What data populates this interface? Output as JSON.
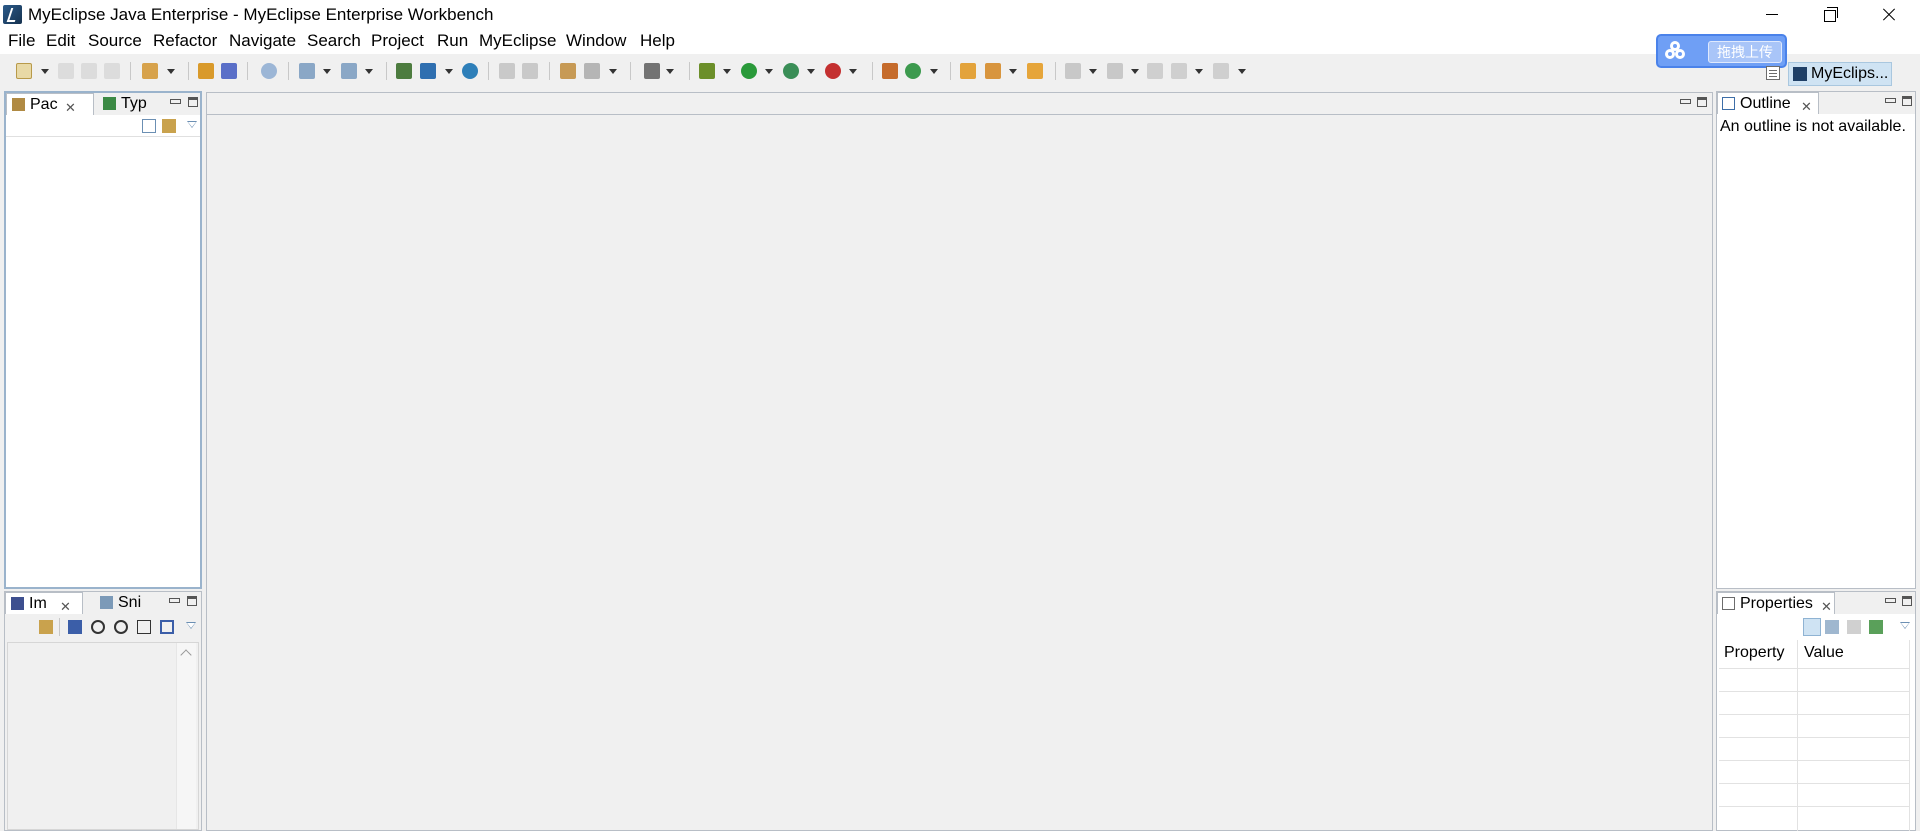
{
  "window": {
    "title": "MyEclipse Java Enterprise - MyEclipse Enterprise Workbench"
  },
  "menu": [
    "File",
    "Edit",
    "Source",
    "Refactor",
    "Navigate",
    "Search",
    "Project",
    "Run",
    "MyEclipse",
    "Window",
    "Help"
  ],
  "upload_widget": {
    "label": "拖拽上传"
  },
  "perspective": {
    "active_label": "MyEclips..."
  },
  "views": {
    "package_explorer": {
      "tabs": [
        "Pac",
        "Typ"
      ]
    },
    "image_preview": {
      "tabs": [
        "Im",
        "Sni"
      ]
    },
    "outline": {
      "tab": "Outline",
      "message": "An outline is not available."
    },
    "properties": {
      "tab": "Properties",
      "columns": [
        "Property",
        "Value"
      ]
    }
  },
  "colors": {
    "background": "#f0f0f0",
    "accent": "#6f9ff5",
    "active_perspective": "#cfe3f3"
  }
}
